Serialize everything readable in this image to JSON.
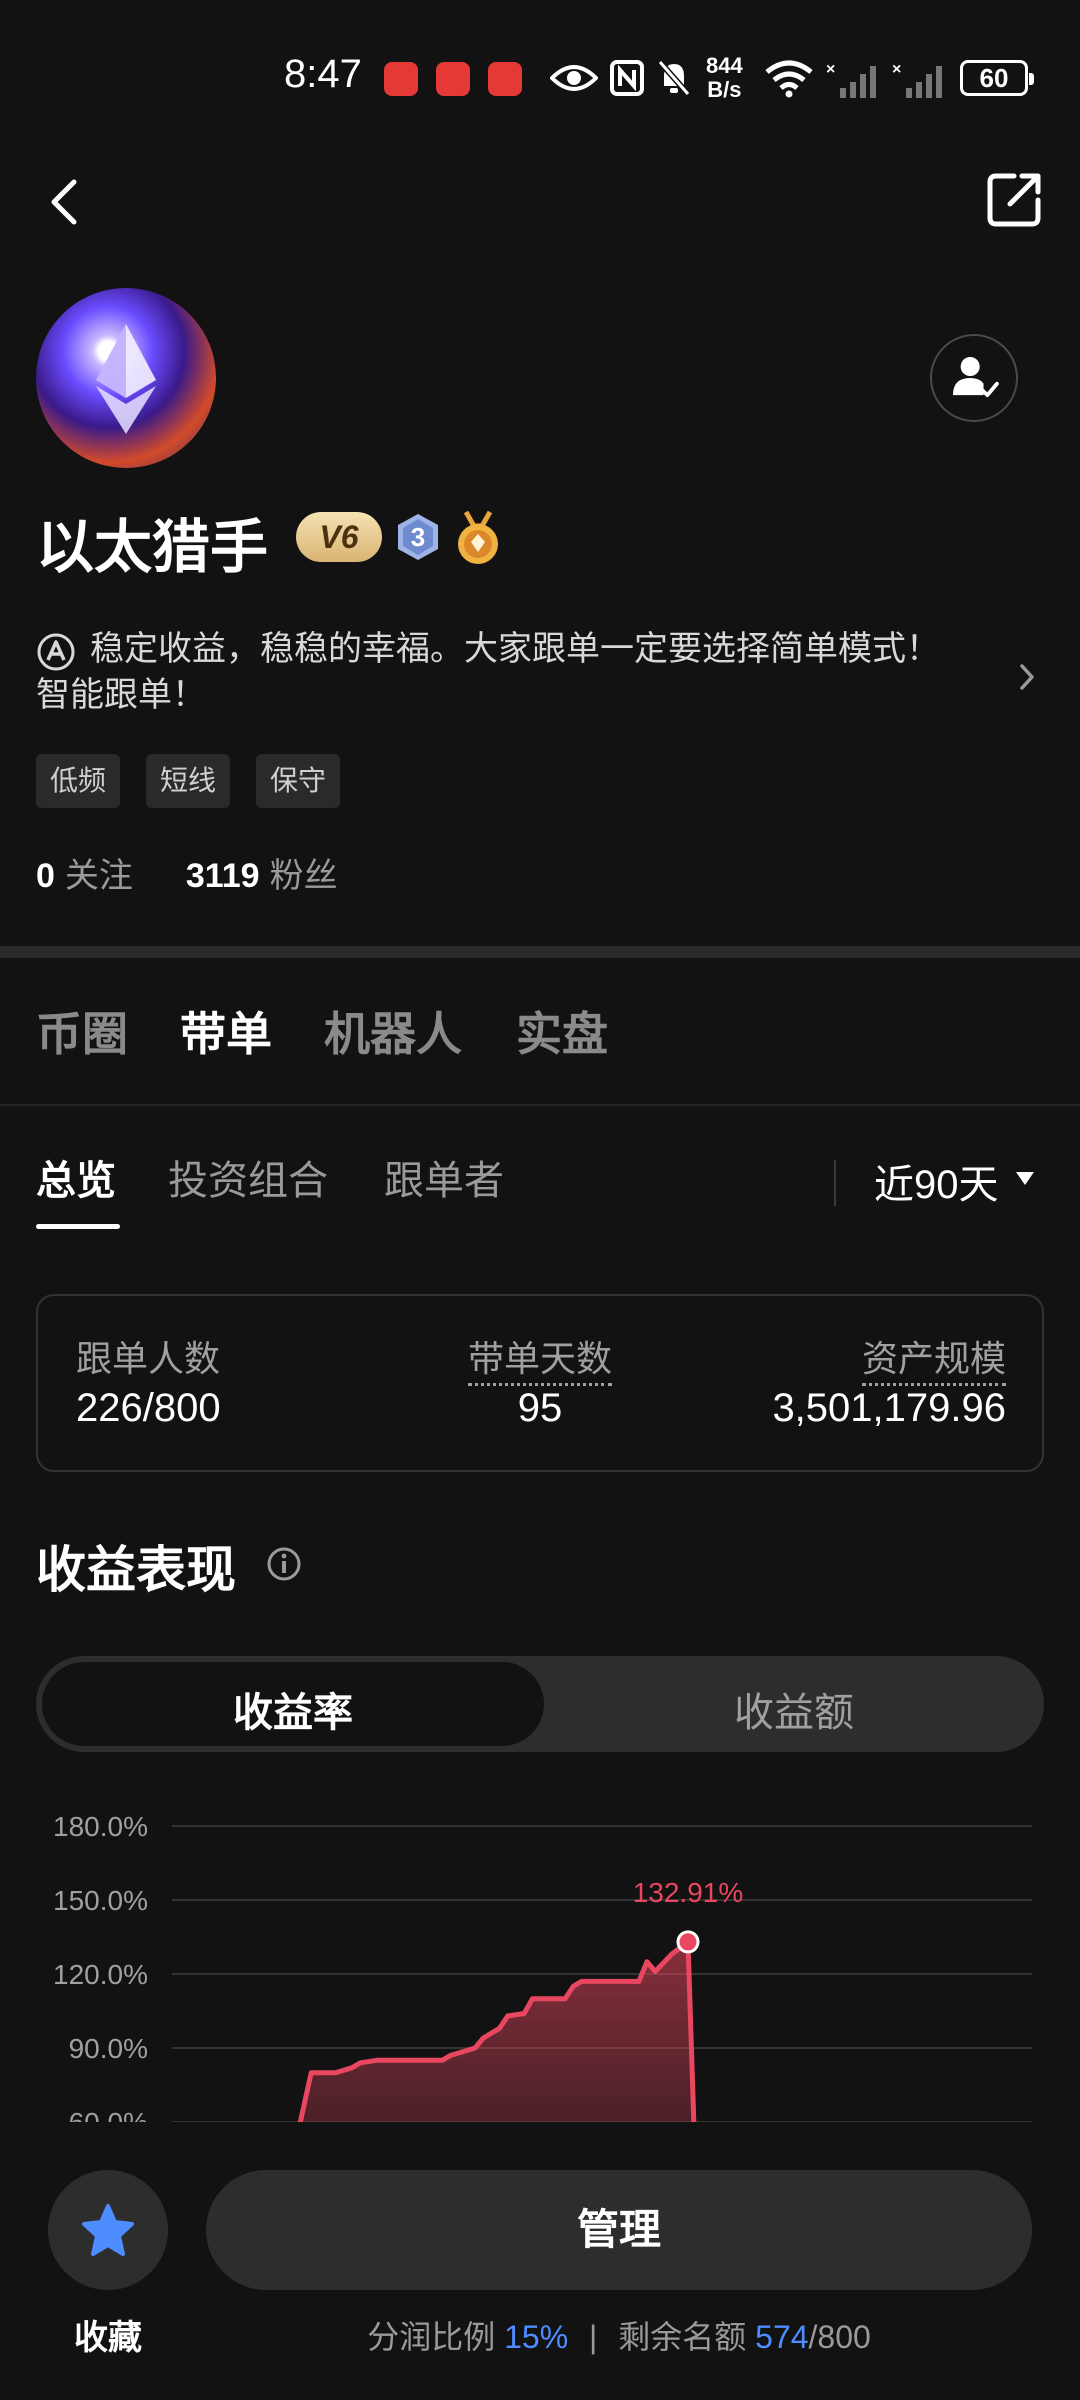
{
  "status_bar": {
    "time": "8:47",
    "net_speed_value": "844",
    "net_speed_unit": "B/s",
    "battery": "60"
  },
  "profile": {
    "name": "以太猎手",
    "vip_badge": "V6",
    "level_badge": "3",
    "bio": "稳定收益，稳稳的幸福。大家跟单一定要选择简单模式！智能跟单！",
    "tags": [
      "低频",
      "短线",
      "保守"
    ],
    "following_count": "0",
    "following_label": "关注",
    "followers_count": "3119",
    "followers_label": "粉丝"
  },
  "main_tabs": [
    {
      "label": "币圈",
      "active": false
    },
    {
      "label": "带单",
      "active": true
    },
    {
      "label": "机器人",
      "active": false
    },
    {
      "label": "实盘",
      "active": false
    }
  ],
  "sub_tabs": [
    {
      "label": "总览",
      "active": true
    },
    {
      "label": "投资组合",
      "active": false
    },
    {
      "label": "跟单者",
      "active": false
    }
  ],
  "period_selector": "近90天",
  "summary_card": {
    "followers_label": "跟单人数",
    "followers_value": "226/800",
    "days_label": "带单天数",
    "days_value": "95",
    "aum_label": "资产规模",
    "aum_value": "3,501,179.96"
  },
  "performance": {
    "title": "收益表现",
    "toggle_rate": "收益率",
    "toggle_amount": "收益额",
    "peak_label": "132.91%"
  },
  "chart_data": {
    "type": "area",
    "title": "",
    "ylabel": "",
    "y_ticks": [
      "180.0%",
      "150.0%",
      "120.0%",
      "90.0%",
      "60.0%"
    ],
    "ylim": [
      60,
      180
    ],
    "grid": true,
    "series": [
      {
        "color": "#e8475f",
        "points": [
          [
            0,
            50
          ],
          [
            2,
            80
          ],
          [
            5,
            80
          ],
          [
            7,
            82
          ],
          [
            8,
            84
          ],
          [
            10,
            85
          ],
          [
            13,
            85
          ],
          [
            15,
            85
          ],
          [
            18,
            85
          ],
          [
            19,
            87
          ],
          [
            21,
            89
          ],
          [
            22,
            90
          ],
          [
            23,
            94
          ],
          [
            25,
            98
          ],
          [
            26,
            103
          ],
          [
            28,
            104
          ],
          [
            29,
            110
          ],
          [
            31,
            110
          ],
          [
            33,
            110
          ],
          [
            34,
            115
          ],
          [
            35,
            117
          ],
          [
            37,
            117
          ],
          [
            40,
            117
          ],
          [
            42,
            117
          ],
          [
            43,
            125
          ],
          [
            44,
            121
          ],
          [
            46,
            128
          ],
          [
            48,
            133
          ],
          [
            49,
            30
          ]
        ]
      }
    ]
  },
  "bottom_bar": {
    "favorite_label": "收藏",
    "manage_label": "管理",
    "profit_share_label": "分润比例",
    "profit_share_value": "15%",
    "separator": "|",
    "remaining_label": "剩余名额",
    "remaining_value": "574",
    "remaining_total": "/800"
  }
}
